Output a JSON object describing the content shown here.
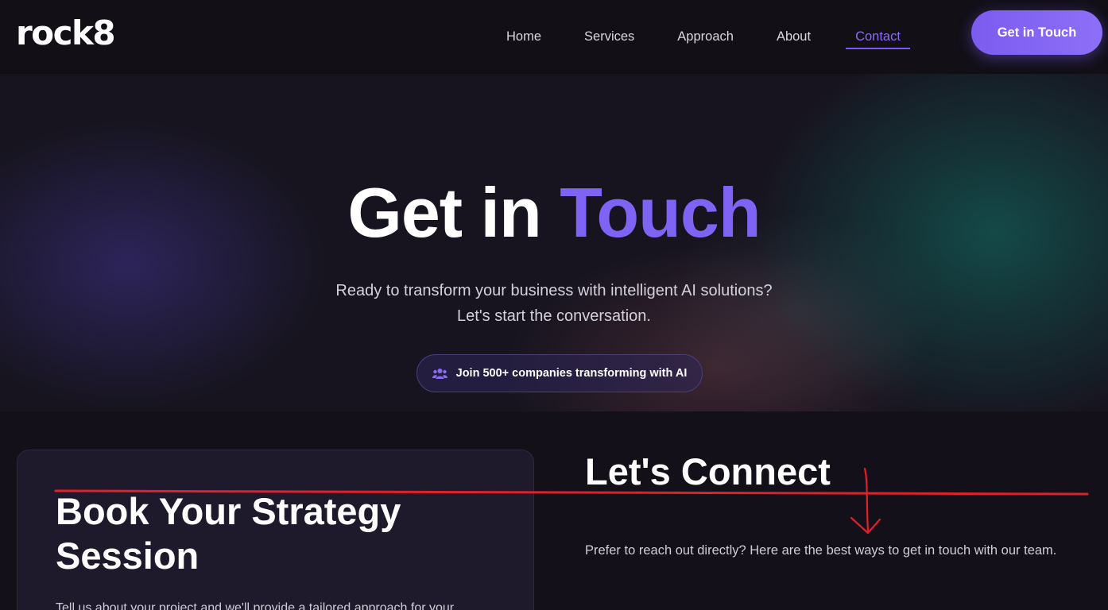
{
  "brand": {
    "logo_text": "rock8"
  },
  "nav": {
    "links": [
      {
        "label": "Home"
      },
      {
        "label": "Services"
      },
      {
        "label": "Approach"
      },
      {
        "label": "About"
      },
      {
        "label": "Contact",
        "active": true
      }
    ],
    "cta_label": "Get in Touch"
  },
  "hero": {
    "title_part1": "Get in",
    "title_part2": "Touch",
    "subtitle_line1": "Ready to transform your business with intelligent AI solutions?",
    "subtitle_line2": "Let's start the conversation.",
    "badge_text": "Join 500+ companies transforming with AI",
    "badge_icon": "users-icon"
  },
  "booking": {
    "title": "Book Your Strategy Session",
    "description": "Tell us about your project and we'll provide a tailored approach for your"
  },
  "connect": {
    "title": "Let's Connect",
    "description": "Prefer to reach out directly? Here are the best ways to get in touch with our team."
  },
  "colors": {
    "accent": "#7f63f4",
    "background": "#131019",
    "annotation": "#e0202a"
  }
}
